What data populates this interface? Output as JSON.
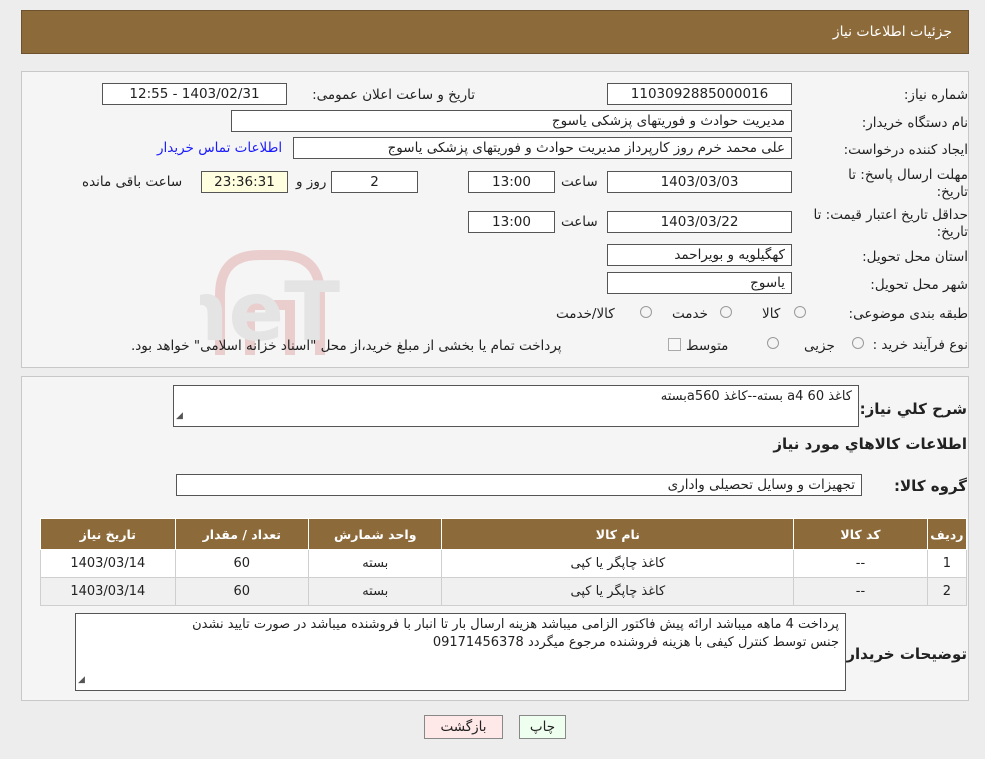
{
  "header": {
    "title": "جزئیات اطلاعات نیاز"
  },
  "form": {
    "need_number_label": "شماره نیاز:",
    "need_number": "1103092885000016",
    "announce_label": "تاریخ و ساعت اعلان عمومی:",
    "announce_value": "1403/02/31 - 12:55",
    "buyer_org_label": "نام دستگاه خریدار:",
    "buyer_org": "مدیریت حوادث و فوریتهای پزشکی یاسوج",
    "creator_label": "ایجاد کننده درخواست:",
    "creator": "علی محمد خرم روز کارپرداز مدیریت حوادث و فوریتهای پزشکی یاسوج",
    "contact_link": "اطلاعات تماس خریدار",
    "deadline_label_1": "مهلت ارسال پاسخ: تا",
    "deadline_label_2": "تاریخ:",
    "deadline_date": "1403/03/03",
    "time_label": "ساعت",
    "deadline_time": "13:00",
    "days_value": "2",
    "days_label": "روز و",
    "remaining_time": "23:36:31",
    "remaining_label": "ساعت باقی مانده",
    "validity_label_1": "حداقل تاریخ اعتبار قیمت: تا",
    "validity_label_2": "تاریخ:",
    "validity_date": "1403/03/22",
    "validity_time": "13:00",
    "province_label": "استان محل تحویل:",
    "province": "کهگیلویه و بویراحمد",
    "city_label": "شهر محل تحویل:",
    "city": "یاسوج",
    "category_label": "طبقه بندی موضوعی:",
    "category_options": [
      "کالا",
      "خدمت",
      "کالا/خدمت"
    ],
    "process_label": "نوع فرآیند خرید :",
    "process_options": [
      "جزیی",
      "متوسط"
    ],
    "process_note": "پرداخت تمام یا بخشی از مبلغ خرید،از محل \"اسناد خزانه اسلامی\" خواهد بود."
  },
  "summary": {
    "label": "شرح کلي نياز:",
    "value": "کاغذ a4 60 بسته--کاغذ a560بسته",
    "items_heading": "اطلاعات کالاهاي مورد نياز",
    "group_label": "گروه کالا:",
    "group_value": "تجهیزات و وسایل تحصیلی واداری"
  },
  "table": {
    "headers": [
      "ردیف",
      "کد کالا",
      "نام کالا",
      "واحد شمارش",
      "تعداد / مقدار",
      "تاریخ نیاز"
    ],
    "rows": [
      [
        "1",
        "--",
        "کاغذ چاپگر یا کپی",
        "بسته",
        "60",
        "1403/03/14"
      ],
      [
        "2",
        "--",
        "کاغذ چاپگر یا کپی",
        "بسته",
        "60",
        "1403/03/14"
      ]
    ]
  },
  "notes": {
    "label": "توضیحات خریدار:",
    "line1": "پرداخت 4 ماهه میباشد  ارائه پیش فاکتور الزامی میباشد  هزینه ارسال بار تا انبار  با فروشنده میباشد در صورت تایید نشدن",
    "line2": "جنس توسط کنترل کیفی با  هزینه فروشنده مرجوع میگردد 09171456378"
  },
  "buttons": {
    "print": "چاپ",
    "back": "بازگشت"
  },
  "watermark": {
    "text": "AriaTender.neT"
  }
}
